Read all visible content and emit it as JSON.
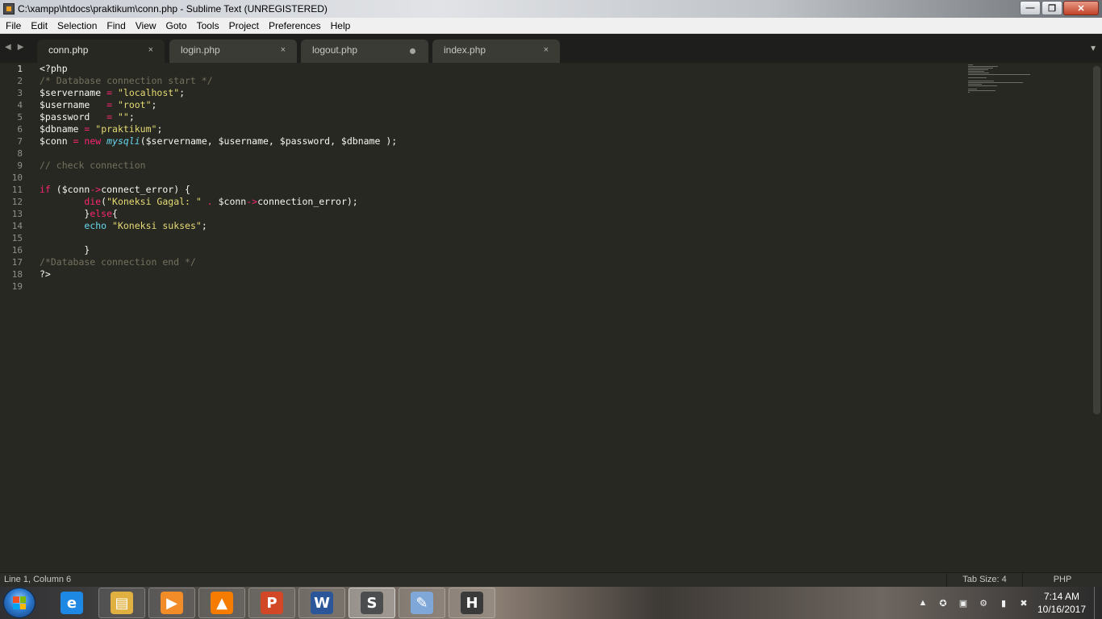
{
  "window": {
    "title": "C:\\xampp\\htdocs\\praktikum\\conn.php - Sublime Text (UNREGISTERED)",
    "controls": {
      "minimize": "—",
      "maximize": "❐",
      "close": "✕"
    }
  },
  "menu": [
    "File",
    "Edit",
    "Selection",
    "Find",
    "View",
    "Goto",
    "Tools",
    "Project",
    "Preferences",
    "Help"
  ],
  "tabs": [
    {
      "label": "conn.php",
      "active": true,
      "close": "×"
    },
    {
      "label": "login.php",
      "active": false,
      "close": "×"
    },
    {
      "label": "logout.php",
      "active": false,
      "dirty": true
    },
    {
      "label": "index.php",
      "active": false,
      "close": "×"
    }
  ],
  "tab_nav": {
    "left": "◀",
    "right": "▶",
    "dropdown": "▼"
  },
  "editor": {
    "line_numbers": [
      "1",
      "2",
      "3",
      "4",
      "5",
      "6",
      "7",
      "8",
      "9",
      "10",
      "11",
      "12",
      "13",
      "14",
      "15",
      "16",
      "17",
      "18",
      "19"
    ],
    "current_line": 1,
    "lines": [
      [
        {
          "t": "<?php",
          "c": "var"
        }
      ],
      [
        {
          "t": "/* Database connection start */",
          "c": "cmt"
        }
      ],
      [
        {
          "t": "$servername ",
          "c": "var"
        },
        {
          "t": "=",
          "c": "op"
        },
        {
          "t": " ",
          "c": "var"
        },
        {
          "t": "\"localhost\"",
          "c": "str"
        },
        {
          "t": ";",
          "c": "var"
        }
      ],
      [
        {
          "t": "$username   ",
          "c": "var"
        },
        {
          "t": "=",
          "c": "op"
        },
        {
          "t": " ",
          "c": "var"
        },
        {
          "t": "\"root\"",
          "c": "str"
        },
        {
          "t": ";",
          "c": "var"
        }
      ],
      [
        {
          "t": "$password   ",
          "c": "var"
        },
        {
          "t": "=",
          "c": "op"
        },
        {
          "t": " ",
          "c": "var"
        },
        {
          "t": "\"\"",
          "c": "str"
        },
        {
          "t": ";",
          "c": "var"
        }
      ],
      [
        {
          "t": "$dbname ",
          "c": "var"
        },
        {
          "t": "=",
          "c": "op"
        },
        {
          "t": " ",
          "c": "var"
        },
        {
          "t": "\"praktikum\"",
          "c": "str"
        },
        {
          "t": ";",
          "c": "var"
        }
      ],
      [
        {
          "t": "$conn ",
          "c": "var"
        },
        {
          "t": "=",
          "c": "op"
        },
        {
          "t": " ",
          "c": "var"
        },
        {
          "t": "new",
          "c": "kw"
        },
        {
          "t": " ",
          "c": "var"
        },
        {
          "t": "mysqli",
          "c": "fn"
        },
        {
          "t": "($servername, $username, $password, $dbname );",
          "c": "var"
        }
      ],
      [],
      [
        {
          "t": "// check connection",
          "c": "cmt"
        }
      ],
      [],
      [
        {
          "t": "if",
          "c": "kw"
        },
        {
          "t": " ($conn",
          "c": "var"
        },
        {
          "t": "->",
          "c": "op"
        },
        {
          "t": "connect_error) {",
          "c": "var"
        }
      ],
      [
        {
          "t": "        ",
          "c": "var"
        },
        {
          "t": "die",
          "c": "kw"
        },
        {
          "t": "(",
          "c": "var"
        },
        {
          "t": "\"Koneksi Gagal: \"",
          "c": "str"
        },
        {
          "t": " ",
          "c": "var"
        },
        {
          "t": ".",
          "c": "op"
        },
        {
          "t": " $conn",
          "c": "var"
        },
        {
          "t": "->",
          "c": "op"
        },
        {
          "t": "connection_error);",
          "c": "var"
        }
      ],
      [
        {
          "t": "        }",
          "c": "var"
        },
        {
          "t": "else",
          "c": "kw"
        },
        {
          "t": "{",
          "c": "var"
        }
      ],
      [
        {
          "t": "        ",
          "c": "var"
        },
        {
          "t": "echo",
          "c": "bi"
        },
        {
          "t": " ",
          "c": "var"
        },
        {
          "t": "\"Koneksi sukses\"",
          "c": "str"
        },
        {
          "t": ";",
          "c": "var"
        }
      ],
      [],
      [
        {
          "t": "        }",
          "c": "var"
        }
      ],
      [
        {
          "t": "/*Database connection end */",
          "c": "cmt"
        }
      ],
      [
        {
          "t": "?>",
          "c": "var"
        }
      ],
      []
    ]
  },
  "status": {
    "position": "Line 1, Column 6",
    "tab_size": "Tab Size: 4",
    "syntax": "PHP"
  },
  "taskbar": {
    "apps": [
      {
        "name": "internet-explorer",
        "glyph": "e",
        "color": "#1e88e5"
      },
      {
        "name": "file-explorer",
        "glyph": "▤",
        "color": "#e0b040"
      },
      {
        "name": "media-player",
        "glyph": "▶",
        "color": "#f28c28"
      },
      {
        "name": "vlc",
        "glyph": "▲",
        "color": "#f57c00"
      },
      {
        "name": "powerpoint",
        "glyph": "P",
        "color": "#d24726"
      },
      {
        "name": "word",
        "glyph": "W",
        "color": "#2b579a"
      },
      {
        "name": "sublime-text",
        "glyph": "S",
        "color": "#4b4d4f"
      },
      {
        "name": "paint",
        "glyph": "✎",
        "color": "#7fa7d8"
      },
      {
        "name": "h-app",
        "glyph": "H",
        "color": "#3a3a3a"
      }
    ],
    "tray_icons": [
      "▲",
      "✪",
      "▣",
      "⚙",
      "▮",
      "✖"
    ],
    "clock_time": "7:14 AM",
    "clock_date": "10/16/2017"
  }
}
